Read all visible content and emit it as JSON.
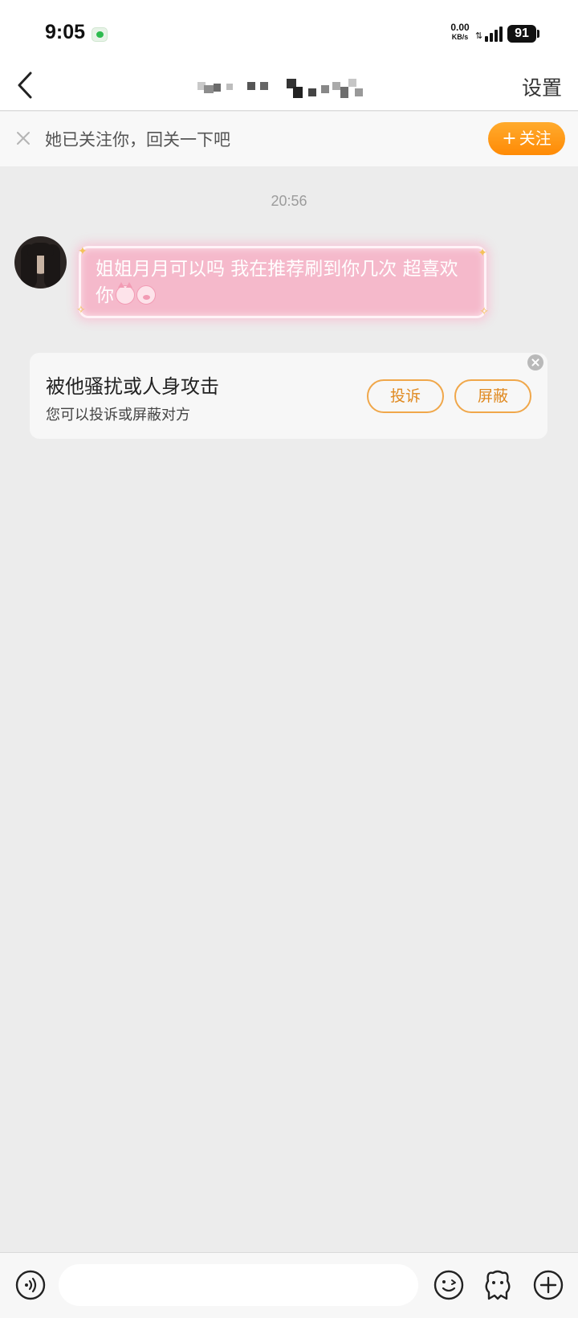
{
  "status_bar": {
    "time": "9:05",
    "net_speed_value": "0.00",
    "net_speed_unit": "KB/s",
    "battery": "91",
    "notification_icon": "wechat-icon"
  },
  "header": {
    "title_redacted": true,
    "settings_label": "设置",
    "back_icon": "chevron-left-icon"
  },
  "follow_banner": {
    "text": "她已关注你，回关一下吧",
    "button_plus": "+",
    "button_label": "关注",
    "accent": "#ff9a1a"
  },
  "chat": {
    "time_divider": "20:56",
    "messages": [
      {
        "text": "姐姐月月可以吗  我在推荐刷到你几次 超喜欢你",
        "emojis": [
          "cat-face-emoji",
          "pig-face-emoji"
        ],
        "bubble_color": "#f5b9cb"
      }
    ]
  },
  "harassment_card": {
    "title": "被他骚扰或人身攻击",
    "subtitle": "您可以投诉或屏蔽对方",
    "report_label": "投诉",
    "block_label": "屏蔽",
    "button_color": "#e08a21"
  },
  "input_bar": {
    "placeholder": "",
    "icons": [
      "voice-icon",
      "emoji-icon",
      "pet-icon",
      "plus-icon"
    ]
  }
}
